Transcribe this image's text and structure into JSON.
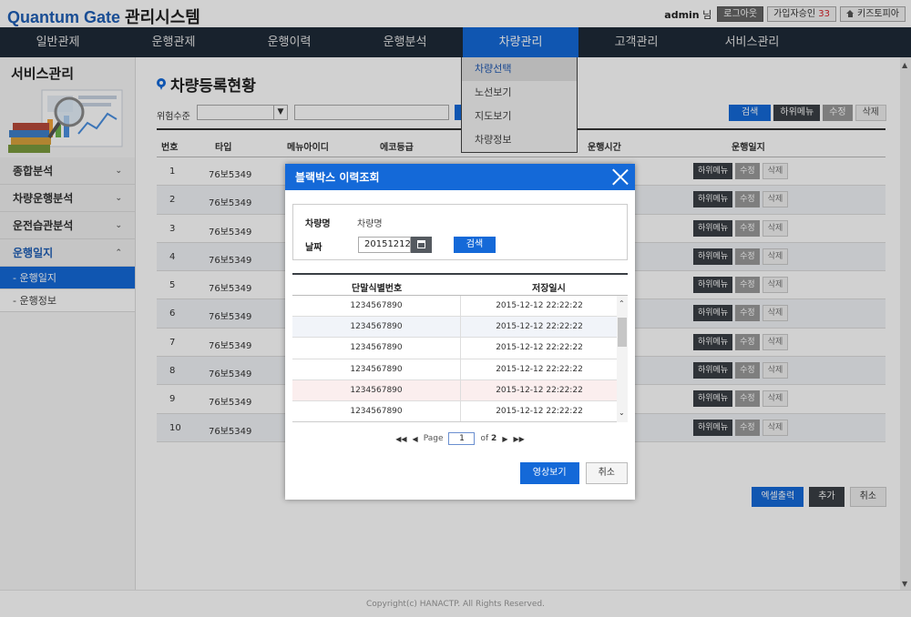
{
  "brand": {
    "name": "Quantum Gate",
    "suffix": "관리시스템"
  },
  "topbar": {
    "user": "admin",
    "user_suffix": "님",
    "logout_label": "로그아웃",
    "approval_label": "가입자승인",
    "approval_count": "33",
    "home_label": "키즈토피아"
  },
  "nav": {
    "items": [
      "일반관제",
      "운행관제",
      "운행이력",
      "운행분석",
      "차량관리",
      "고객관리",
      "서비스관리"
    ],
    "active_index": 4
  },
  "dropdown": {
    "items": [
      "차량선택",
      "노선보기",
      "지도보기",
      "차량정보"
    ],
    "active_index": 0
  },
  "sidebar": {
    "title": "서비스관리",
    "menu": [
      {
        "label": "종합분석"
      },
      {
        "label": "차량운행분석"
      },
      {
        "label": "운전습관분석"
      },
      {
        "label": "운행일지"
      }
    ],
    "submenu": [
      "- 운행일지",
      "- 운행정보"
    ]
  },
  "page": {
    "title": "차량등록현황",
    "filter_label": "위험수준",
    "buttons": {
      "search": "검색",
      "submenu": "하위메뉴",
      "edit": "수정",
      "delete": "삭제"
    },
    "columns": [
      "번호",
      "타입",
      "메뉴아이디",
      "에코등급",
      "운행시간",
      "운행일지"
    ],
    "rows": [
      {
        "num": "1",
        "type": "76보5349"
      },
      {
        "num": "2",
        "type": "76보5349"
      },
      {
        "num": "3",
        "type": "76보5349"
      },
      {
        "num": "4",
        "type": "76보5349"
      },
      {
        "num": "5",
        "type": "76보5349"
      },
      {
        "num": "6",
        "type": "76보5349"
      },
      {
        "num": "7",
        "type": "76보5349"
      },
      {
        "num": "8",
        "type": "76보5349"
      },
      {
        "num": "9",
        "type": "76보5349"
      },
      {
        "num": "10",
        "type": "76보5349"
      }
    ],
    "row_actions": {
      "submenu": "하위메뉴",
      "edit": "수정",
      "delete": "삭제"
    },
    "bottom": {
      "excel": "엑셀출력",
      "add": "추가",
      "cancel": "취소"
    }
  },
  "modal": {
    "title": "블랙박스 이력조회",
    "vehicle_label": "차량명",
    "vehicle_value": "차량명",
    "date_label": "날짜",
    "date_value": "20151212",
    "search_label": "검색",
    "columns": [
      "단말식별번호",
      "저장일시"
    ],
    "rows": [
      {
        "id": "1234567890",
        "saved": "2015-12-12 22:22:22"
      },
      {
        "id": "1234567890",
        "saved": "2015-12-12 22:22:22"
      },
      {
        "id": "1234567890",
        "saved": "2015-12-12 22:22:22"
      },
      {
        "id": "1234567890",
        "saved": "2015-12-12 22:22:22"
      },
      {
        "id": "1234567890",
        "saved": "2015-12-12 22:22:22"
      },
      {
        "id": "1234567890",
        "saved": "2015-12-12 22:22:22"
      }
    ],
    "pager": {
      "page_label": "Page",
      "page": "1",
      "of_label": "of",
      "total": "2"
    },
    "view_label": "영상보기",
    "cancel_label": "취소"
  },
  "footer": "Copyright(c) HANACTP. All Rights Reserved.",
  "colors": {
    "primary": "#1469d8",
    "nav": "#1e2a38",
    "dark_btn": "#3a3f45"
  }
}
